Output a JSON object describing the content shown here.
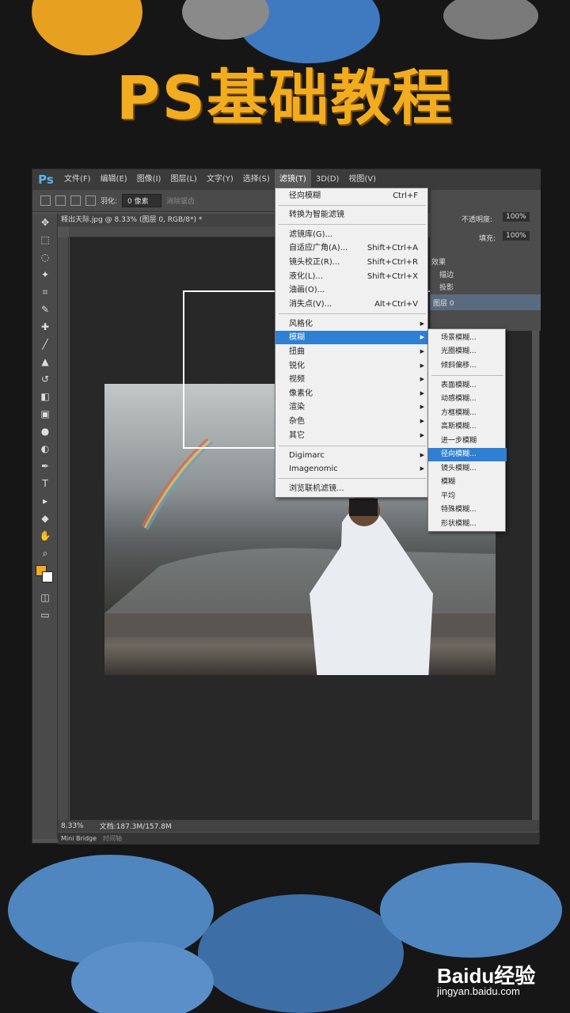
{
  "banner_title": "PS基础教程",
  "app": {
    "logo": "Ps"
  },
  "menubar": [
    "文件(F)",
    "编辑(E)",
    "图像(I)",
    "图层(L)",
    "文字(Y)",
    "选择(S)",
    "滤镜(T)",
    "3D(D)",
    "视图(V)"
  ],
  "active_menu": "滤镜(T)",
  "options": {
    "feather_label": "羽化:",
    "feather_value": "0 像素",
    "antialias_label": "消除锯齿"
  },
  "doc_tab": "释出天际.jpg @ 8.33% (图层 0, RGB/8*) *",
  "filter_menu": {
    "items": [
      {
        "label": "径向模糊",
        "shortcut": "Ctrl+F"
      },
      {
        "label": "转换为智能滤镜",
        "shortcut": ""
      },
      {
        "label": "滤镜库(G)...",
        "shortcut": ""
      },
      {
        "label": "自适应广角(A)...",
        "shortcut": "Shift+Ctrl+A"
      },
      {
        "label": "镜头校正(R)...",
        "shortcut": "Shift+Ctrl+R"
      },
      {
        "label": "液化(L)...",
        "shortcut": "Shift+Ctrl+X"
      },
      {
        "label": "油画(O)...",
        "shortcut": ""
      },
      {
        "label": "消失点(V)...",
        "shortcut": "Alt+Ctrl+V"
      },
      {
        "label": "风格化",
        "shortcut": ""
      },
      {
        "label": "模糊",
        "shortcut": ""
      },
      {
        "label": "扭曲",
        "shortcut": ""
      },
      {
        "label": "锐化",
        "shortcut": ""
      },
      {
        "label": "视频",
        "shortcut": ""
      },
      {
        "label": "像素化",
        "shortcut": ""
      },
      {
        "label": "渲染",
        "shortcut": ""
      },
      {
        "label": "杂色",
        "shortcut": ""
      },
      {
        "label": "其它",
        "shortcut": ""
      },
      {
        "label": "Digimarc",
        "shortcut": ""
      },
      {
        "label": "Imagenomic",
        "shortcut": ""
      },
      {
        "label": "浏览联机滤镜...",
        "shortcut": ""
      }
    ]
  },
  "blur_submenu": [
    "场景模糊...",
    "光圈模糊...",
    "倾斜偏移...",
    "表面模糊...",
    "动感模糊...",
    "方框模糊...",
    "高斯模糊...",
    "进一步模糊",
    "径向模糊...",
    "镜头模糊...",
    "模糊",
    "平均",
    "特殊模糊...",
    "形状模糊..."
  ],
  "highlighted_submenu": "径向模糊...",
  "panel": {
    "opacity_label": "不透明度:",
    "opacity_value": "100%",
    "fill_label": "填充:",
    "fill_value": "100%",
    "effects": "效果",
    "stroke": "描边",
    "shadow": "投影",
    "layer": "图层 0"
  },
  "status": {
    "zoom": "8.33%",
    "doc": "文档:187.3M/157.8M"
  },
  "bottom_tabs": [
    "Mini Bridge",
    "时间轴"
  ],
  "watermark": {
    "brand": "Baidu经验",
    "url": "jingyan.baidu.com"
  },
  "colors": {
    "title": "#f2ac20",
    "highlight": "#2f7fd2",
    "splash_blue": "#4f86bf"
  }
}
